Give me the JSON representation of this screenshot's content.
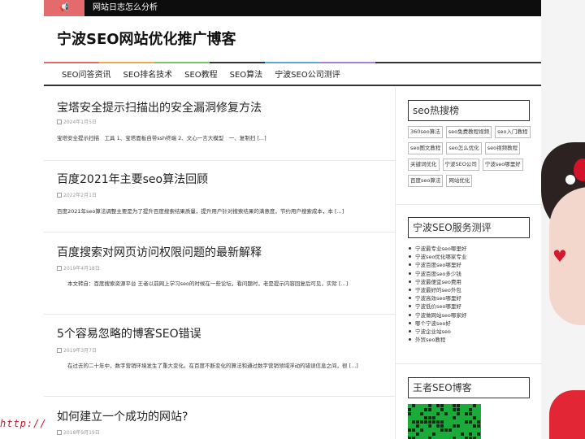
{
  "topbar": {
    "news_text": "网站日志怎么分析"
  },
  "header": {
    "site_title": "宁波SEO网站优化推广博客"
  },
  "nav": [
    "SEO问答资讯",
    "SEO排名技术",
    "SEO教程",
    "SEO算法",
    "宁波SEO公司测评"
  ],
  "posts": [
    {
      "title": "宝塔安全提示扫描出的安全漏洞修复方法",
      "date": "2024年1月5日",
      "excerpt": "宝塔安全提示扫描　工具 1、宝塔面板自带ssh终端 2、文心一言大模型　一、复制扫 [...]"
    },
    {
      "title": "百度2021年主要seo算法回顾",
      "date": "2022年2月1日",
      "excerpt": "百度2021年seo算法调整主要是为了提升百度搜索结果质量，提升用户针对搜索结果的满意度，节约用户搜索成本，本 [...]"
    },
    {
      "title": "百度搜索对网页访问权限问题的最新解释",
      "date": "2019年4月18日",
      "excerpt": "　　本文转自：百度搜索资源平台 王者以前网上学习seo的时候在一些论坛，看问题时，老是提示内容回复后可见，实际 [...]"
    },
    {
      "title": "5个容易忽略的博客SEO错误",
      "date": "2019年3月7日",
      "excerpt": "　　在过去的二十年中，数字营销环境发生了重大变化。在百度不断变化的算法和通过数字营销领域浮动的错误信息之间，很 [...]"
    },
    {
      "title": "如何建立一个成功的网站?",
      "date": "2018年9月19日",
      "excerpt": ""
    }
  ],
  "sidebar": {
    "hot_title": "seo热搜榜",
    "tags": [
      "360seo算法",
      "seo免费教程视频",
      "seo入门教程",
      "seo图文教程",
      "seo怎么优化",
      "seo视频教程",
      "关键词优化",
      "宁波SEO公司",
      "宁波seo哪里好",
      "百度seo算法",
      "网站优化"
    ],
    "service_title": "宁波SEO服务测评",
    "service_links": [
      "宁波最专业seo哪里好",
      "宁波seo优化哪家专业",
      "宁波百度seo哪里好",
      "宁波百度seo多少钱",
      "宁波最便宜seo费用",
      "宁波最好的seo外包",
      "宁波高效seo哪里好",
      "宁波低价seo哪里好",
      "宁波做网站seo哪家好",
      "哪个宁波seo好",
      "宁波企业站seo",
      "外贸seo教程"
    ],
    "blog_title": "王者SEO博客"
  },
  "background": {
    "overlay_text": "http://"
  },
  "colors": {
    "accent_tag": "#e46b6b",
    "topbar": "#0d0d0d",
    "stripes": [
      "#e46b6b",
      "#f0a64a",
      "#7cc46d",
      "#5aa9d6",
      "#a97fd0",
      "#e46b6b"
    ]
  }
}
